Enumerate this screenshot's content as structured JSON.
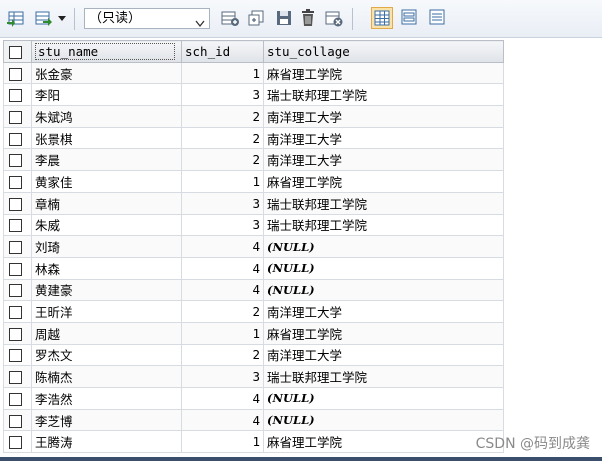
{
  "toolbar": {
    "mode_value": "（只读）",
    "buttons": [
      "grid-insert-icon",
      "export-icon",
      "add-row-icon",
      "duplicate-icon",
      "save-icon",
      "delete-icon",
      "refresh-icon"
    ],
    "views": [
      "grid-view-icon",
      "form-view-icon",
      "text-view-icon"
    ],
    "accent": "#fbe2a9"
  },
  "grid": {
    "columns": [
      "stu_name",
      "sch_id",
      "stu_collage"
    ],
    "rows": [
      {
        "name": "张金豪",
        "sch_id": "1",
        "collage": "麻省理工学院"
      },
      {
        "name": "李阳",
        "sch_id": "3",
        "collage": "瑞士联邦理工学院"
      },
      {
        "name": "朱斌鸿",
        "sch_id": "2",
        "collage": "南洋理工大学"
      },
      {
        "name": "张景棋",
        "sch_id": "2",
        "collage": "南洋理工大学"
      },
      {
        "name": "李晨",
        "sch_id": "2",
        "collage": "南洋理工大学"
      },
      {
        "name": "黄家佳",
        "sch_id": "1",
        "collage": "麻省理工学院"
      },
      {
        "name": "章楠",
        "sch_id": "3",
        "collage": "瑞士联邦理工学院"
      },
      {
        "name": "朱威",
        "sch_id": "3",
        "collage": "瑞士联邦理工学院"
      },
      {
        "name": "刘琦",
        "sch_id": "4",
        "collage": "(NULL)"
      },
      {
        "name": "林森",
        "sch_id": "4",
        "collage": "(NULL)"
      },
      {
        "name": "黄建豪",
        "sch_id": "4",
        "collage": "(NULL)"
      },
      {
        "name": "王昕洋",
        "sch_id": "2",
        "collage": "南洋理工大学"
      },
      {
        "name": "周越",
        "sch_id": "1",
        "collage": "麻省理工学院"
      },
      {
        "name": "罗杰文",
        "sch_id": "2",
        "collage": "南洋理工大学"
      },
      {
        "name": "陈楠杰",
        "sch_id": "3",
        "collage": "瑞士联邦理工学院"
      },
      {
        "name": "李浩然",
        "sch_id": "4",
        "collage": "(NULL)"
      },
      {
        "name": "李芝博",
        "sch_id": "4",
        "collage": "(NULL)"
      },
      {
        "name": "王腾涛",
        "sch_id": "1",
        "collage": "麻省理工学院"
      }
    ]
  },
  "watermark": "CSDN @码到成龚"
}
